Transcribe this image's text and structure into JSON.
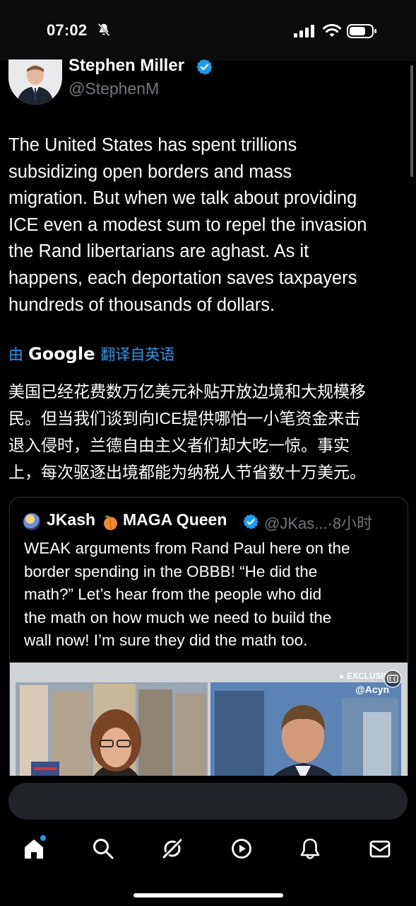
{
  "status_bar": {
    "time": "07:02"
  },
  "author": {
    "name": "Stephen Miller",
    "handle": "@StephenM"
  },
  "tweet": {
    "text_lines": [
      "The United States has spent trillions",
      "subsidizing open borders and mass",
      "migration. But when we talk about providing",
      "ICE even a modest sum to repel the invasion",
      "the Rand libertarians are aghast. As it",
      "happens, each deportation saves taxpayers",
      "hundreds of thousands of dollars."
    ],
    "translation": {
      "prefix": "由",
      "provider": "Google",
      "suffix": "翻译自英语",
      "text_lines": [
        "美国已经花费数万亿美元补贴开放边境和大规模移",
        "民。但当我们谈到向ICE提供哪怕一小笔资金来击",
        "退入侵时，兰德自由主义者们却大吃一惊。事实",
        "上，每次驱逐出境都能为纳税人节省数十万美元。"
      ]
    }
  },
  "quote": {
    "name_part1": "JKash",
    "name_part2": "MAGA Queen",
    "meta": "@JKas...·8小时",
    "text_lines": [
      "WEAK arguments from Rand Paul here on the",
      "border spending in the OBBB!  “He did the",
      "math?”  Let’s hear from the people who  did",
      "the math on how much we need to build the",
      "wall now!  I’m sure they did the math too."
    ],
    "media": {
      "badge": "▸ EXCLUSIVE",
      "watermark": "@Acyn"
    }
  },
  "composer": {
    "placeholder": ""
  },
  "nav": {
    "items": [
      "home-icon",
      "search-icon",
      "grok-icon",
      "video-icon",
      "notifications-icon",
      "messages-icon"
    ]
  },
  "colors": {
    "accent": "#1d9bf0",
    "background": "#000000",
    "muted_text": "#71767b"
  }
}
